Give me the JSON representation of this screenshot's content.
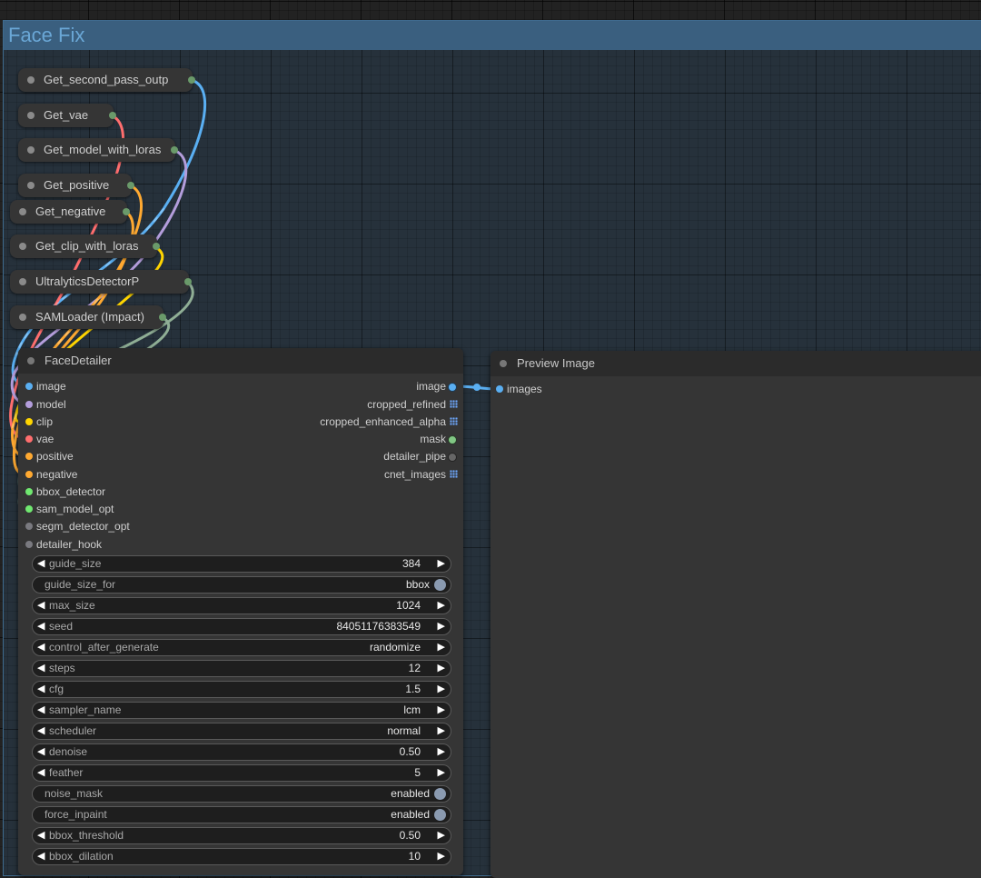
{
  "group": {
    "title": "Face Fix"
  },
  "colors": {
    "image": "#5aaff2",
    "model": "#b39ddb",
    "clip": "#ffd500",
    "vae": "#ff6e6e",
    "conditioning": "#ffa931",
    "detector": "#70e870",
    "disabled_port": "#7a7a80",
    "mask": "#81c784",
    "pipe": "#666666"
  },
  "get_nodes": [
    {
      "label": "Get_second_pass_outp"
    },
    {
      "label": "Get_vae"
    },
    {
      "label": "Get_model_with_loras"
    },
    {
      "label": "Get_positive"
    },
    {
      "label": "Get_negative"
    },
    {
      "label": "Get_clip_with_loras"
    },
    {
      "label": "UltralyticsDetectorP"
    },
    {
      "label": "SAMLoader (Impact)"
    }
  ],
  "face_detailer": {
    "title": "FaceDetailer",
    "inputs": [
      {
        "name": "image"
      },
      {
        "name": "model"
      },
      {
        "name": "clip"
      },
      {
        "name": "vae"
      },
      {
        "name": "positive"
      },
      {
        "name": "negative"
      },
      {
        "name": "bbox_detector"
      },
      {
        "name": "sam_model_opt"
      },
      {
        "name": "segm_detector_opt"
      },
      {
        "name": "detailer_hook"
      }
    ],
    "outputs": [
      {
        "name": "image"
      },
      {
        "name": "cropped_refined"
      },
      {
        "name": "cropped_enhanced_alpha"
      },
      {
        "name": "mask"
      },
      {
        "name": "detailer_pipe"
      },
      {
        "name": "cnet_images"
      }
    ],
    "widgets": [
      {
        "name": "guide_size",
        "value": "384",
        "kind": "number"
      },
      {
        "name": "guide_size_for",
        "value": "bbox",
        "kind": "toggle"
      },
      {
        "name": "max_size",
        "value": "1024",
        "kind": "number"
      },
      {
        "name": "seed",
        "value": "84051176383549",
        "kind": "number"
      },
      {
        "name": "control_after_generate",
        "value": "randomize",
        "kind": "combo"
      },
      {
        "name": "steps",
        "value": "12",
        "kind": "number"
      },
      {
        "name": "cfg",
        "value": "1.5",
        "kind": "number"
      },
      {
        "name": "sampler_name",
        "value": "lcm",
        "kind": "combo"
      },
      {
        "name": "scheduler",
        "value": "normal",
        "kind": "combo"
      },
      {
        "name": "denoise",
        "value": "0.50",
        "kind": "number"
      },
      {
        "name": "feather",
        "value": "5",
        "kind": "number"
      },
      {
        "name": "noise_mask",
        "value": "enabled",
        "kind": "toggle"
      },
      {
        "name": "force_inpaint",
        "value": "enabled",
        "kind": "toggle"
      },
      {
        "name": "bbox_threshold",
        "value": "0.50",
        "kind": "number"
      },
      {
        "name": "bbox_dilation",
        "value": "10",
        "kind": "number"
      }
    ]
  },
  "preview": {
    "title": "Preview Image",
    "input": "images"
  }
}
